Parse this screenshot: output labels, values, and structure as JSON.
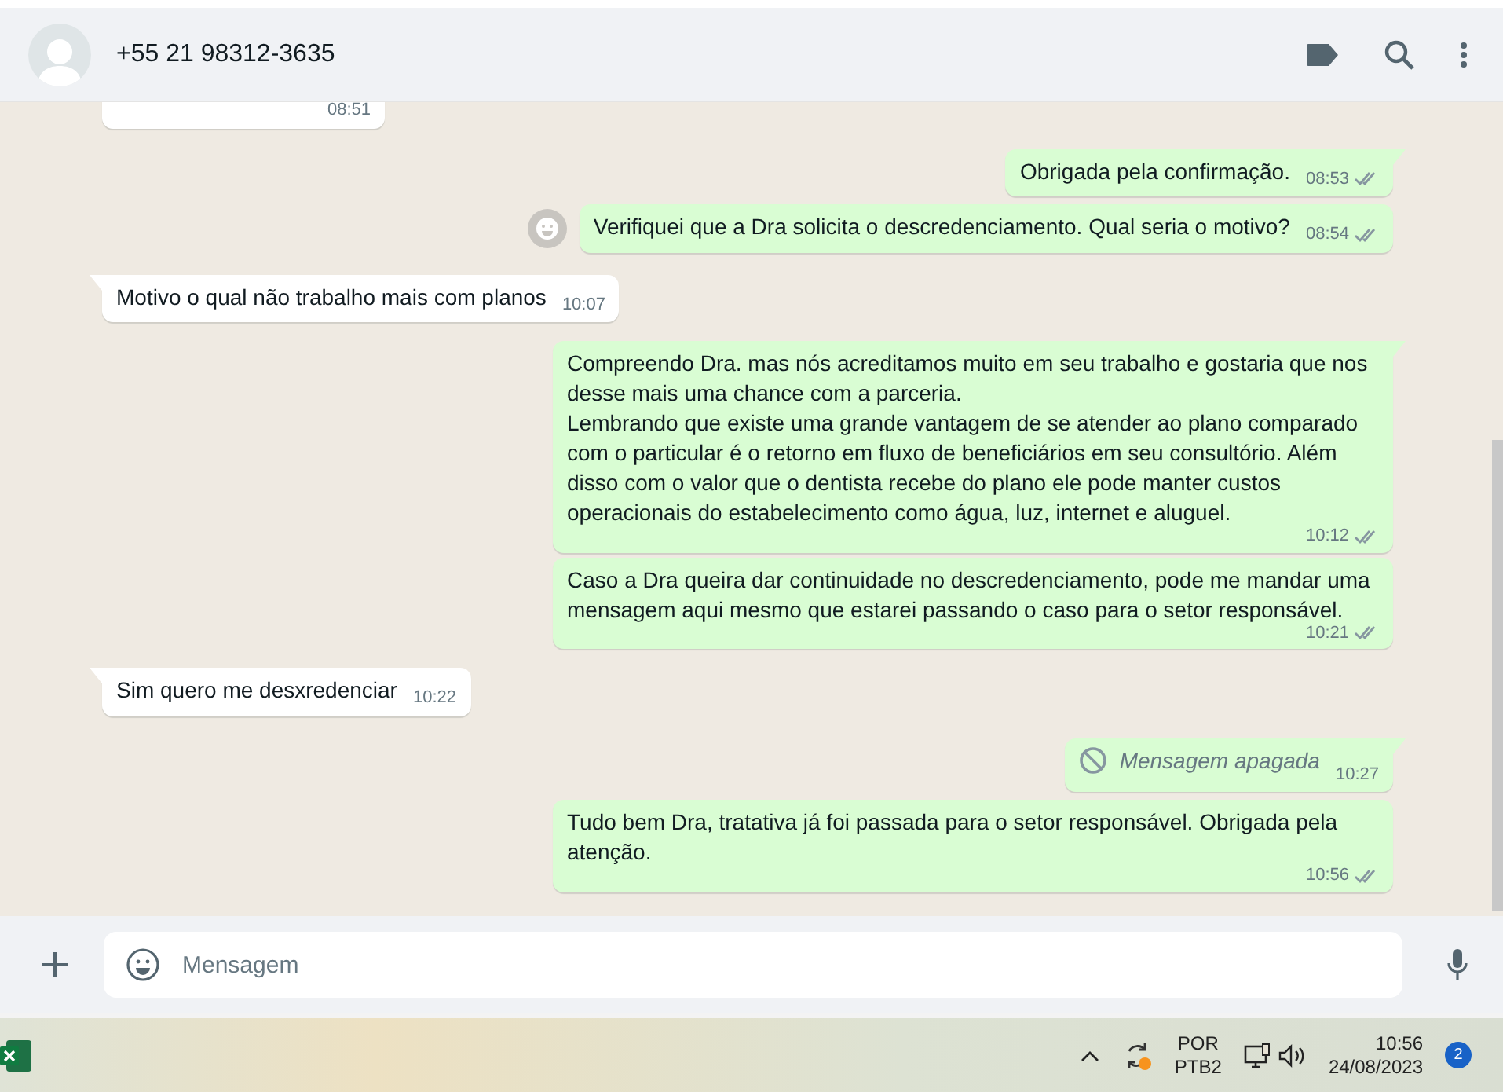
{
  "header": {
    "contact": "+55 21 98312-3635"
  },
  "messages": [
    {
      "kind": "incoming",
      "time": "08:51"
    },
    {
      "kind": "outgoing",
      "text": "Obrigada pela confirmação.",
      "time": "08:53",
      "tail": true,
      "read": false
    },
    {
      "kind": "outgoing",
      "text": "Verifiquei que a Dra solicita o descredenciamento. Qual seria o motivo?",
      "time": "08:54",
      "tail": false,
      "read": false,
      "react_button": true
    },
    {
      "kind": "incoming",
      "text": "Motivo o qual não trabalho mais com planos",
      "time": "10:07",
      "tail": true
    },
    {
      "kind": "outgoing",
      "text": "Compreendo Dra. mas nós acreditamos muito em seu trabalho e gostaria que nos desse mais uma chance com a parceria.\nLembrando que existe uma grande vantagem de se atender ao plano comparado com o particular é o retorno em fluxo de beneficiários em seu consultório. Além disso com o valor que o dentista recebe do plano ele pode manter custos operacionais do estabelecimento como água, luz, internet e aluguel.",
      "time": "10:12",
      "tail": true,
      "read": false
    },
    {
      "kind": "outgoing",
      "text": "Caso a Dra queira dar continuidade no descredenciamento, pode me mandar uma mensagem aqui mesmo que estarei passando o caso para o setor responsável.",
      "time": "10:21",
      "tail": false,
      "read": false
    },
    {
      "kind": "incoming",
      "text": "Sim quero me desxredenciar",
      "time": "10:22",
      "tail": true
    },
    {
      "kind": "deleted",
      "text": "Mensagem apagada",
      "time": "10:27",
      "tail": true
    },
    {
      "kind": "outgoing",
      "text": "Tudo bem Dra, tratativa já foi passada para o setor responsável. Obrigada pela atenção.",
      "time": "10:56",
      "tail": false,
      "read": false
    }
  ],
  "composer": {
    "placeholder": "Mensagem"
  },
  "taskbar": {
    "language": "POR",
    "layout": "PTB2",
    "time": "10:56",
    "date": "24/08/2023",
    "notifications": "2",
    "sync_alert": true
  }
}
